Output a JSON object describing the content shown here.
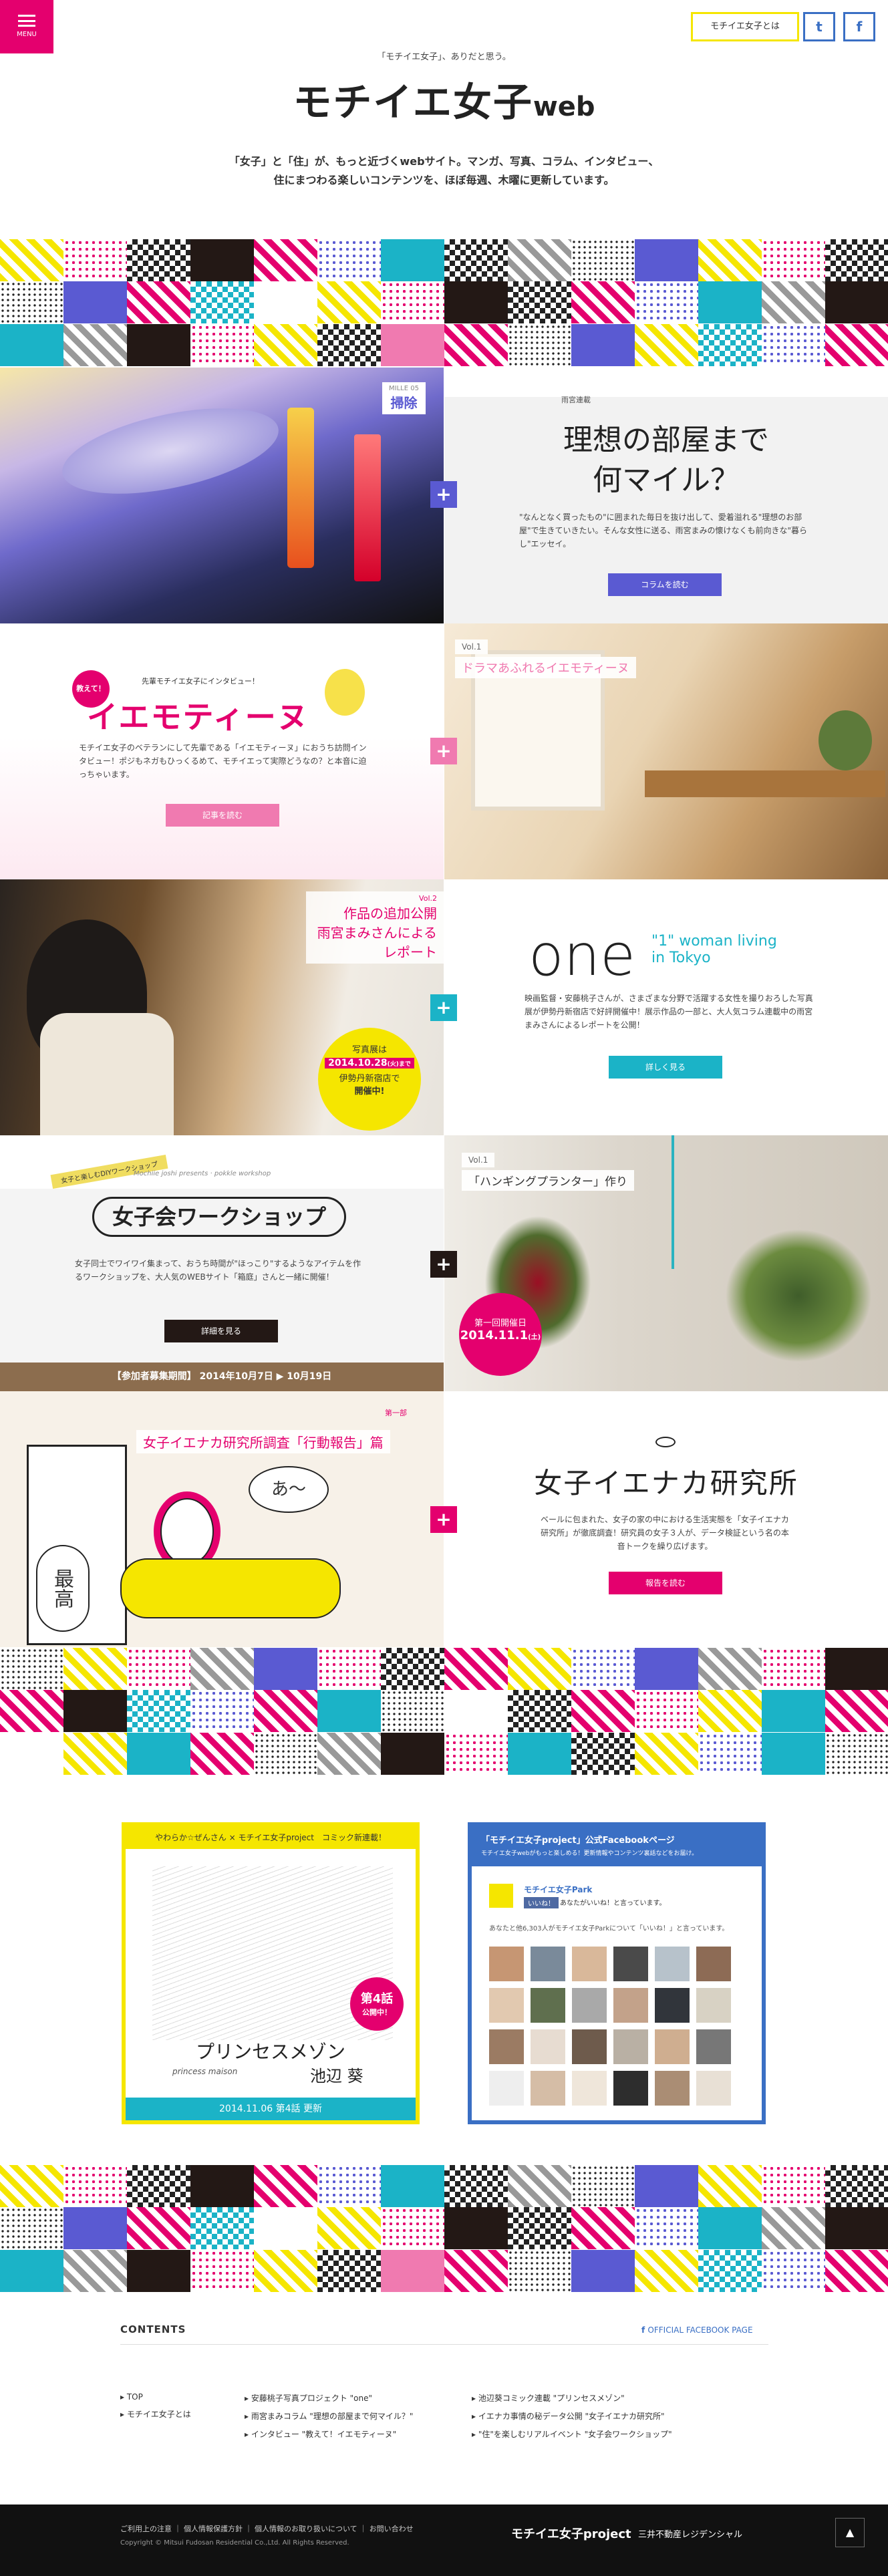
{
  "header": {
    "menu_label": "MENU",
    "about_label": "モチイエ女子とは",
    "tw_icon": "twitter-icon",
    "fb_icon": "facebook-icon",
    "tagline": "「モチイエ女子」、ありだと思う。",
    "logo_main": "モチイエ女子",
    "logo_web": "web",
    "intro_line1": "「女子」と「住」が、もっと近づくwebサイト。マンガ、写真、コラム、インタビュー、",
    "intro_line2": "住にまつわる楽しいコンテンツを、ほぼ毎週、木曜に更新しています。"
  },
  "rows": [
    {
      "left_badge_top": "MILLE 05",
      "left_badge_main": "掃除",
      "right_kicker": "雨宮連載",
      "right_title_1": "理想の部屋まで",
      "right_title_2": "何マイル？",
      "right_body": "\"なんとなく買ったもの\"に囲まれた毎日を抜け出して、愛着溢れる\"理想のお部屋\"で生きていきたい。そんな女性に送る、雨宮まみの懐けなくも前向きな\"暮らし\"エッセイ。",
      "cta": "コラムを読む"
    },
    {
      "tag": "教えて！",
      "kicker": "先輩モチイエ女子にインタビュー！",
      "title": "イエモティーヌ",
      "body": "モチイエ女子のベテランにして先輩である「イエモティーヌ」におうち訪問インタビュー！ポジもネガもひっくるめて、モチイエって実際どうなの？と本音に迫っちゃいます。",
      "cta": "記事を読む",
      "vol": "Vol.1",
      "photo_caption": "ドラマあふれるイエモティーヌ"
    },
    {
      "vol": "Vol.2",
      "caption_1": "作品の追加公開",
      "caption_2": "雨宮まみさんによるレポート",
      "show_label": "写真展は",
      "show_date": "2014.10.28",
      "show_date_suffix": "(火)まで",
      "show_place": "伊勢丹新宿店で",
      "show_status": "開催中!",
      "one_big": "one",
      "one_sub_1": "\"1\" woman living",
      "one_sub_2": "in Tokyo",
      "body": "映画監督・安藤桃子さんが、さまざまな分野で活躍する女性を撮りおろした写真展が伊勢丹新宿店で好評開催中！展示作品の一部と、大人気コラム連載中の雨宮まみさんによるレポートを公開！",
      "cta": "詳しく見る"
    },
    {
      "ribbon": "女子と楽しむDIYワークショップ",
      "script": "Mochiie joshi presents · pokkle workshop",
      "title": "女子会ワークショップ",
      "body": "女子同士でワイワイ集まって、おうち時間が\"ほっこり\"するようなアイテムを作るワークショップを、大人気のWEBサイト「箱庭」さんと一緒に開催！",
      "cta": "詳細を見る",
      "period": "【参加者募集期間】 2014年10月7日 ▶ 10月19日",
      "vol": "Vol.1",
      "project": "「ハンギングプランター」作り",
      "date_label": "第一回開催日",
      "date": "2014.11.1",
      "date_suffix": "(土)"
    },
    {
      "part": "第一部",
      "caption": "女子イエナカ研究所調査「行動報告」篇",
      "bubble_1": "あ～",
      "bubble_2": "最高",
      "title": "女子イエナカ研究所",
      "body": "ベールに包まれた、女子の家の中における生活実態を「女子イエナカ研究所」が徹底調査！研究員の女子３人が、データ検証という名の本音トークを繰り広げます。",
      "cta": "報告を読む"
    }
  ],
  "comic": {
    "header": "やわらか☆ぜんさん × モチイエ女子project　コミック新連載！",
    "badge_1": "第4話",
    "badge_2": "公開中！",
    "title": "プリンセスメゾン",
    "title_en": "princess maison",
    "author": "池辺 葵",
    "footer": "2014.11.06 第4話 更新"
  },
  "facebook": {
    "header_title": "「モチイエ女子project」公式Facebookページ",
    "header_sub": "モチイエ女子webがもっと楽しめる！更新情報やコンテンツ裏話などをお届け。",
    "page_name": "モチイエ女子Park",
    "like_label": "いいね！",
    "like_text": "あなたがいいね！と言っています。",
    "count_text": "あなたと他6,303人がモチイエ女子Parkについて「いいね！」と言っています。"
  },
  "contents": {
    "title": "CONTENTS",
    "fb_link": "OFFICIAL FACEBOOK PAGE",
    "col1": [
      "TOP",
      "モチイエ女子とは"
    ],
    "col2": [
      "安藤桃子写真プロジェクト \"one\"",
      "雨宮まみコラム \"理想の部屋まで何マイル？\"",
      "インタビュー \"教えて！イエモティーヌ\""
    ],
    "col3": [
      "池辺葵コミック連載 \"プリンセスメゾン\"",
      "イエナカ事情の秘データ公開 \"女子イエナカ研究所\"",
      "\"住\"を楽しむリアルイベント \"女子会ワークショップ\""
    ]
  },
  "footer": {
    "links": [
      "ご利用上の注意",
      "個人情報保護方針",
      "個人情報のお取り扱いについて",
      "お問い合わせ"
    ],
    "copyright": "Copyright © Mitsui Fudosan Residential Co.,Ltd. All Rights Reserved.",
    "logo_1": "モチイエ女子project",
    "logo_2": "三井不動産レジデンシャル"
  },
  "colors": {
    "pink": "#e4006e",
    "blue": "#5a5ad2",
    "teal": "#1bb3c7",
    "yellow": "#f5e600",
    "dark": "#231815"
  }
}
